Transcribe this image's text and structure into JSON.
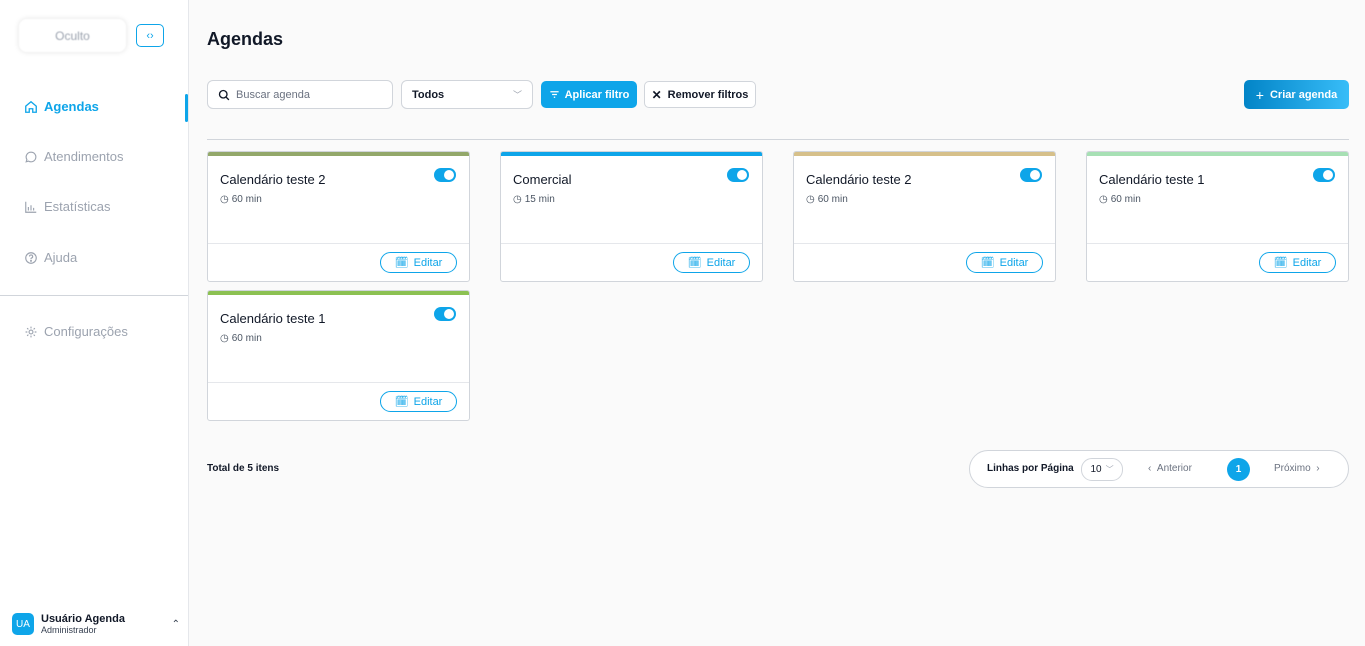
{
  "sidebar": {
    "logo_text": "Oculto",
    "collapse_icon": "code-brackets-icon",
    "items": [
      {
        "label": "Agendas",
        "icon": "home-icon",
        "active": true
      },
      {
        "label": "Atendimentos",
        "icon": "chat-bubble-icon",
        "active": false
      },
      {
        "label": "Estatísticas",
        "icon": "bar-chart-icon",
        "active": false
      },
      {
        "label": "Ajuda",
        "icon": "help-circle-icon",
        "active": false
      },
      {
        "label": "Configurações",
        "icon": "gear-icon",
        "active": false
      }
    ],
    "user": {
      "initials": "UA",
      "name": "Usuário Agenda",
      "role": "Administrador"
    }
  },
  "header": {
    "title": "Agendas"
  },
  "toolbar": {
    "search_placeholder": "Buscar agenda",
    "filter_value": "Todos",
    "apply_label": "Aplicar filtro",
    "remove_label": "Remover filtros",
    "create_label": "Criar agenda"
  },
  "cards": [
    {
      "name": "Calendário teste 2",
      "duration": "60 min",
      "color": "#93a86a",
      "enabled": true,
      "edit_label": "Editar"
    },
    {
      "name": "Comercial",
      "duration": "15 min",
      "color": "#0ea5e9",
      "enabled": true,
      "edit_label": "Editar"
    },
    {
      "name": "Calendário teste 2",
      "duration": "60 min",
      "color": "#d6c08a",
      "enabled": true,
      "edit_label": "Editar"
    },
    {
      "name": "Calendário teste 1",
      "duration": "60 min",
      "color": "#a7e0b4",
      "enabled": true,
      "edit_label": "Editar"
    },
    {
      "name": "Calendário teste 1",
      "duration": "60 min",
      "color": "#8cc152",
      "enabled": true,
      "edit_label": "Editar"
    }
  ],
  "footer": {
    "total_text": "Total de 5 itens",
    "rows_label": "Linhas por Página",
    "rows_value": "10",
    "prev_label": "Anterior",
    "current_page": "1",
    "next_label": "Próximo"
  },
  "colors": {
    "accent": "#0ea5e9"
  }
}
